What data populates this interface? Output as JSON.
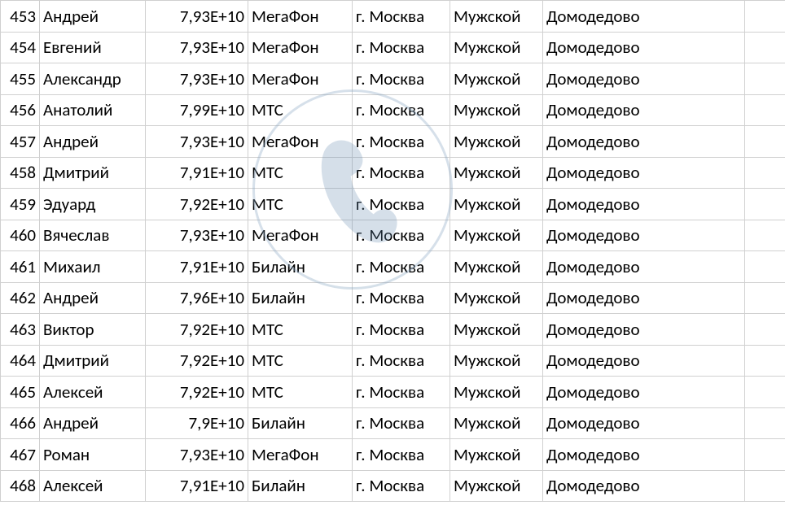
{
  "rows": [
    {
      "n": "453",
      "name": "Андрей",
      "phone": "7,93E+10",
      "operator": "МегаФон",
      "city": "г. Москва",
      "gender": "Мужской",
      "district": "Домодедово"
    },
    {
      "n": "454",
      "name": "Евгений",
      "phone": "7,93E+10",
      "operator": "МегаФон",
      "city": "г. Москва",
      "gender": "Мужской",
      "district": "Домодедово"
    },
    {
      "n": "455",
      "name": "Александр",
      "phone": "7,93E+10",
      "operator": "МегаФон",
      "city": "г. Москва",
      "gender": "Мужской",
      "district": "Домодедово"
    },
    {
      "n": "456",
      "name": "Анатолий",
      "phone": "7,99E+10",
      "operator": "МТС",
      "city": "г. Москва",
      "gender": "Мужской",
      "district": "Домодедово"
    },
    {
      "n": "457",
      "name": "Андрей",
      "phone": "7,93E+10",
      "operator": "МегаФон",
      "city": "г. Москва",
      "gender": "Мужской",
      "district": "Домодедово"
    },
    {
      "n": "458",
      "name": "Дмитрий",
      "phone": "7,91E+10",
      "operator": "МТС",
      "city": "г. Москва",
      "gender": "Мужской",
      "district": "Домодедово"
    },
    {
      "n": "459",
      "name": "Эдуард",
      "phone": "7,92E+10",
      "operator": "МТС",
      "city": "г. Москва",
      "gender": "Мужской",
      "district": "Домодедово"
    },
    {
      "n": "460",
      "name": "Вячеслав",
      "phone": "7,93E+10",
      "operator": "МегаФон",
      "city": "г. Москва",
      "gender": "Мужской",
      "district": "Домодедово"
    },
    {
      "n": "461",
      "name": "Михаил",
      "phone": "7,91E+10",
      "operator": "Билайн",
      "city": "г. Москва",
      "gender": "Мужской",
      "district": "Домодедово"
    },
    {
      "n": "462",
      "name": "Андрей",
      "phone": "7,96E+10",
      "operator": "Билайн",
      "city": "г. Москва",
      "gender": "Мужской",
      "district": "Домодедово"
    },
    {
      "n": "463",
      "name": "Виктор",
      "phone": "7,92E+10",
      "operator": "МТС",
      "city": "г. Москва",
      "gender": "Мужской",
      "district": "Домодедово"
    },
    {
      "n": "464",
      "name": "Дмитрий",
      "phone": "7,92E+10",
      "operator": "МТС",
      "city": "г. Москва",
      "gender": "Мужской",
      "district": "Домодедово"
    },
    {
      "n": "465",
      "name": "Алексей",
      "phone": "7,92E+10",
      "operator": "МТС",
      "city": "г. Москва",
      "gender": "Мужской",
      "district": "Домодедово"
    },
    {
      "n": "466",
      "name": "Андрей",
      "phone": "7,9E+10",
      "operator": "Билайн",
      "city": "г. Москва",
      "gender": "Мужской",
      "district": "Домодедово"
    },
    {
      "n": "467",
      "name": "Роман",
      "phone": "7,93E+10",
      "operator": "МегаФон",
      "city": "г. Москва",
      "gender": "Мужской",
      "district": "Домодедово"
    },
    {
      "n": "468",
      "name": "Алексей",
      "phone": "7,91E+10",
      "operator": "Билайн",
      "city": "г. Москва",
      "gender": "Мужской",
      "district": "Домодедово"
    }
  ]
}
